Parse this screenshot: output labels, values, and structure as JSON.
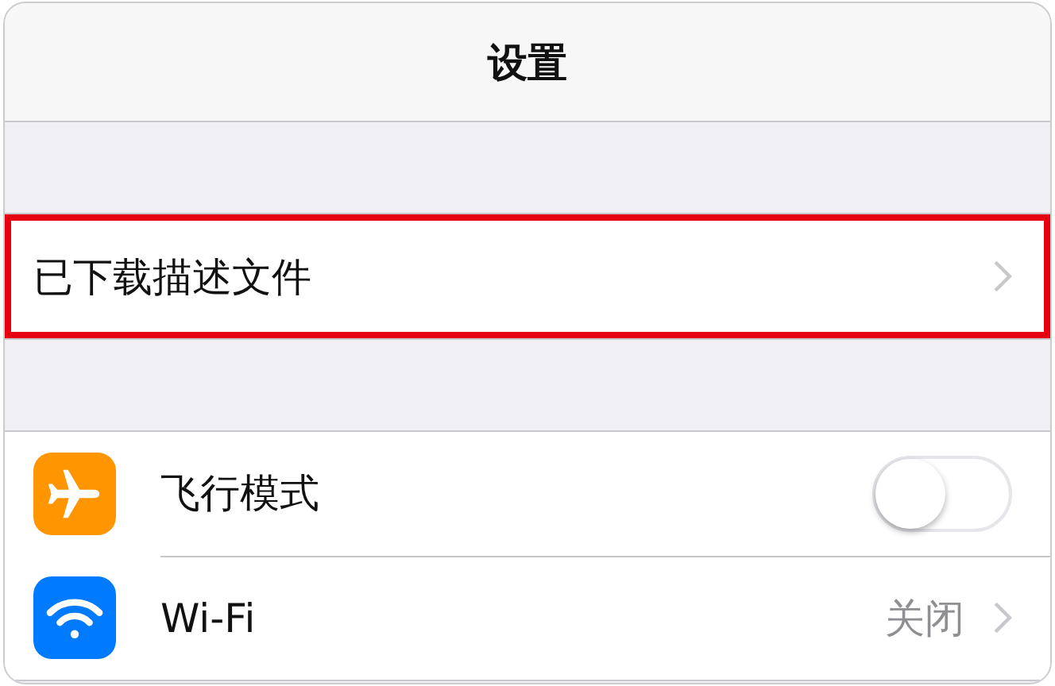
{
  "nav_bar": {
    "title": "设置"
  },
  "sections": [
    {
      "items": [
        {
          "kind": "link",
          "label": "已下载描述文件",
          "highlighted": true
        }
      ]
    },
    {
      "items": [
        {
          "kind": "toggle",
          "label": "飞行模式",
          "color": "#ff9500",
          "on": false
        },
        {
          "kind": "link",
          "label": "Wi-Fi",
          "color": "#007aff",
          "value": "关闭",
          "highlighted": false
        }
      ]
    }
  ]
}
